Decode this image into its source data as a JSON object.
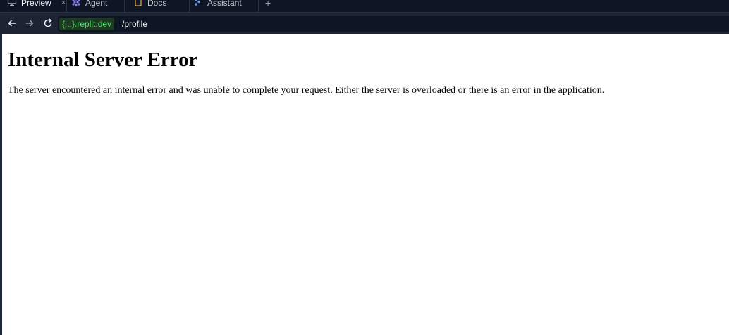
{
  "tabs": [
    {
      "label": "Preview",
      "icon": "monitor-icon",
      "active": true,
      "close": "×"
    },
    {
      "label": "Agent",
      "icon": "agent-icon",
      "active": false
    },
    {
      "label": "Docs",
      "icon": "document-icon",
      "active": false
    },
    {
      "label": "Assistant",
      "icon": "assistant-icon",
      "active": false
    }
  ],
  "new_tab_label": "+",
  "nav": {
    "back_icon": "arrow-left-icon",
    "forward_icon": "arrow-right-icon",
    "reload_icon": "reload-icon"
  },
  "url": {
    "domain": "{...}.replit.dev",
    "path": "/profile"
  },
  "page": {
    "title": "Internal Server Error",
    "message": "The server encountered an internal error and was unable to complete your request. Either the server is overloaded or there is an error in the application."
  },
  "colors": {
    "chrome_bg": "#0e1525",
    "urlbar_bg": "#1c2333",
    "domain_green": "#58e07a",
    "page_bg": "#ffffff"
  }
}
